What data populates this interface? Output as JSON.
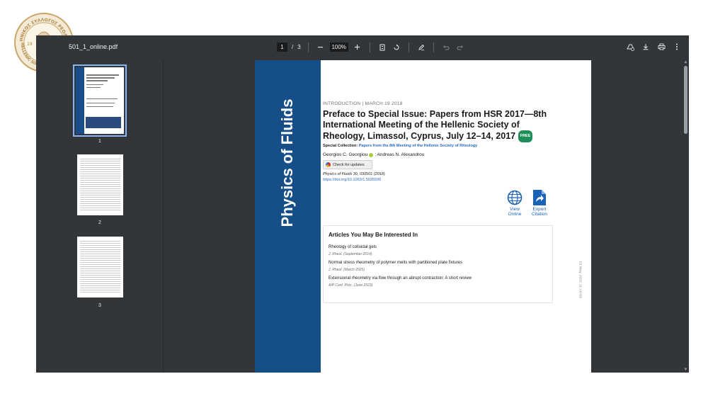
{
  "toolbar": {
    "file_name": "501_1_online.pdf",
    "page_current": "1",
    "page_sep": "/",
    "page_total": "3",
    "zoom": "100%"
  },
  "thumbnails": [
    {
      "label": "1"
    },
    {
      "label": "2"
    },
    {
      "label": "3"
    }
  ],
  "page": {
    "spine_title": "Physics of Fluids",
    "intro_line": "INTRODUCTION  |  MARCH 19 2018",
    "title": "Preface to Special Issue: Papers from HSR 2017—8th International Meeting of the Hellenic Society of Rheology, Limassol, Cyprus, July 12–14, 2017",
    "free_badge": "FREE",
    "special_collection_label": "Special Collection:",
    "special_collection_link": "Papers from the 8th Meeting of the Hellenic Society of Rheology",
    "author1": "Georgios C. Georgiou",
    "author_sep": "; Andreas N. Alexandrou",
    "check_updates": "Check for updates",
    "journal_name": "Physics of Fluids",
    "journal_ref": " 30, 030501 (2018)",
    "doi": "https://doi.org/10.1063/1.5026596",
    "view_online": [
      "View",
      "Online"
    ],
    "export_citation": [
      "Export",
      "Citation"
    ],
    "related_heading": "Articles You May Be Interested In",
    "related": [
      {
        "title": "Rheology of colloidal gels",
        "source": "J. Rheol. (September 2014)"
      },
      {
        "title": "Normal stress rheometry of polymer melts with partitioned plate fixtures",
        "source": "J. Rheol. (March 2025)"
      },
      {
        "title": "Extensional rheometry via flow through an abrupt contraction: A short review",
        "source": "AIP Conf. Proc. (June 2023)"
      }
    ],
    "side_stamp": "23 May 2025 11:10:56"
  },
  "seal": {
    "text_greek": "ΕΛΛΗΝΙΚΟΣ ΣΥΛΛΟΓΟΣ ΡΕΟΛΟΓΙΑΣ",
    "text_english": "HELLENIC SOCIETY OF RHEOLOGY",
    "year_left": "19",
    "year_right": "96",
    "motto": "Τα πάντα ρεί"
  },
  "colors": {
    "viewer_bg": "#323639",
    "spine_blue": "#164e87",
    "link_blue": "#2a6ac7",
    "free_green": "#1f8f5a",
    "seal_gold": "#c9a86a"
  }
}
